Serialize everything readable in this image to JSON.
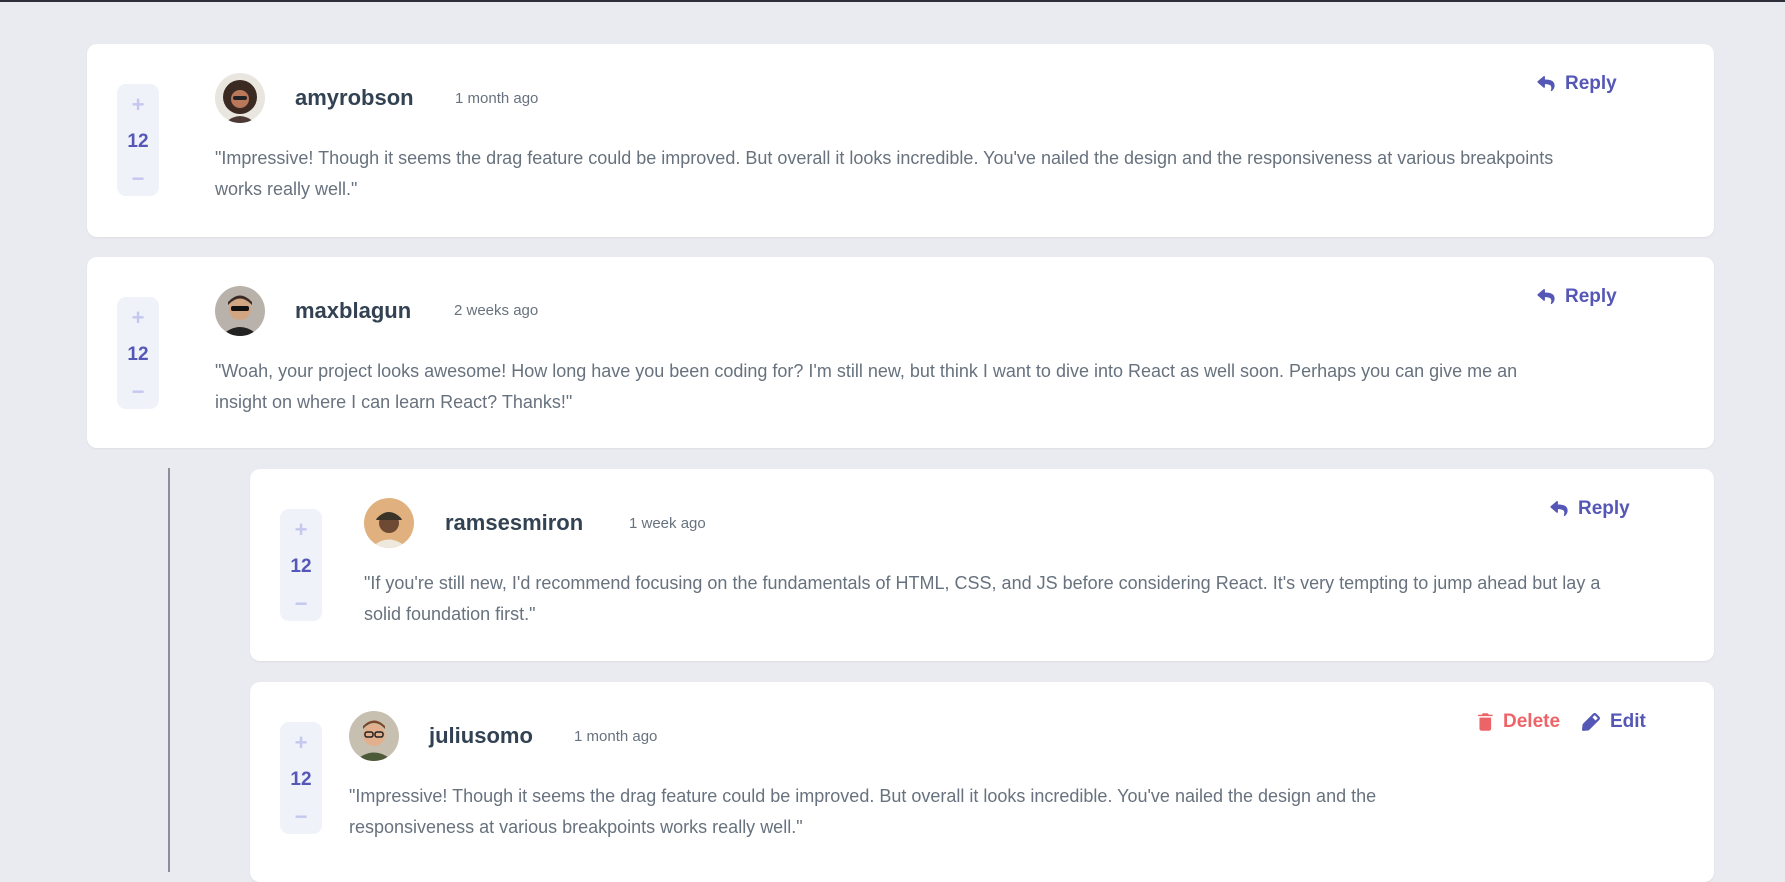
{
  "colors": {
    "background": "#eaebf0",
    "card": "#ffffff",
    "accent": "#5457b6",
    "accent_light": "#c4c7ee",
    "danger": "#ed6468",
    "text": "#67727e",
    "heading": "#334253"
  },
  "comments": [
    {
      "username": "amyrobson",
      "time": "1 month ago",
      "score": "12",
      "text": "\"Impressive! Though it seems the drag feature could be improved. But overall it looks incredible. You've nailed the design and the responsiveness at various breakpoints works really well.\"",
      "action": "Reply"
    },
    {
      "username": "maxblagun",
      "time": "2 weeks ago",
      "score": "12",
      "text": "\"Woah, your project looks awesome! How long have you been coding for? I'm still new, but think I want to dive into React as well soon. Perhaps you can give me an insight on where I can learn React? Thanks!\"",
      "action": "Reply"
    }
  ],
  "replies": [
    {
      "username": "ramsesmiron",
      "time": "1 week ago",
      "score": "12",
      "text": "\"If you're still new, I'd recommend focusing on the fundamentals of HTML, CSS, and JS before considering React. It's very tempting to jump ahead but lay a solid foundation first.\"",
      "action": "Reply"
    },
    {
      "username": "juliusomo",
      "time": "1 month ago",
      "score": "12",
      "text": "\"Impressive! Though it seems the drag feature could be improved. But overall it looks incredible. You've nailed the design and the responsiveness at various breakpoints works really well.\"",
      "delete_label": "Delete",
      "edit_label": "Edit"
    }
  ],
  "icons": {
    "upvote": "plus-icon",
    "downvote": "minus-icon",
    "reply": "reply-arrow-icon",
    "delete": "trash-icon",
    "edit": "pencil-icon"
  }
}
